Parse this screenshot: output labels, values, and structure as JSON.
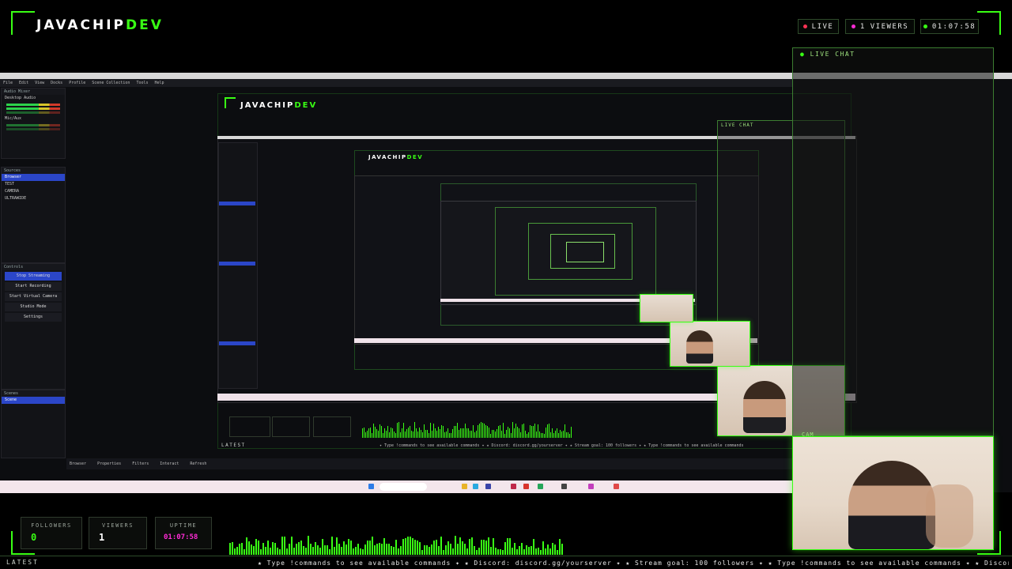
{
  "header": {
    "brand_main": "JAVACHIP",
    "brand_accent": "DEV",
    "live_label": "LIVE",
    "viewers_count": "1",
    "viewers_label": "VIEWERS",
    "uptime": "01:07:58"
  },
  "chat": {
    "title": "LIVE CHAT"
  },
  "cam": {
    "label": "CAM"
  },
  "stats": {
    "followers_label": "FOLLOWERS",
    "followers_value": "0",
    "viewers_label": "VIEWERS",
    "viewers_value": "1",
    "uptime_label": "UPTIME",
    "uptime_value": "01:07:58"
  },
  "footer": {
    "latest_label": "LATEST",
    "ticker": "★ Type !commands to see available commands ✦ ★ Discord: discord.gg/yourserver ✦ ★ Stream goal: 100 followers ✦ ★ Type !commands to see available commands ✦ ★ Discord: discord.gg/yourserver ✦ ★"
  },
  "obs": {
    "menu": [
      "File",
      "Edit",
      "View",
      "Docks",
      "Profile",
      "Scene Collection",
      "Tools",
      "Help"
    ],
    "audio_mixer_title": "Audio Mixer",
    "audio_tracks": [
      "Desktop Audio",
      "Mic/Aux"
    ],
    "sources_title": "Sources",
    "sources": [
      "Browser",
      "TEST",
      "CAMERA",
      "ULTRAWIDE"
    ],
    "controls_title": "Controls",
    "controls": [
      "Stop Streaming",
      "Start Recording",
      "Start Virtual Camera",
      "Studio Mode",
      "Settings"
    ],
    "scenes_title": "Scenes",
    "scenes": [
      "Scene"
    ],
    "bottom_tabs": [
      "Browser",
      "Properties",
      "Filters",
      "Interact",
      "Refresh"
    ]
  },
  "colors": {
    "accent": "#39ff14",
    "live_dot": "#ff3355",
    "viewers_dot": "#ff2bd6",
    "uptime_dot": "#39ff14",
    "uptime_value": "#ff2bd6"
  }
}
